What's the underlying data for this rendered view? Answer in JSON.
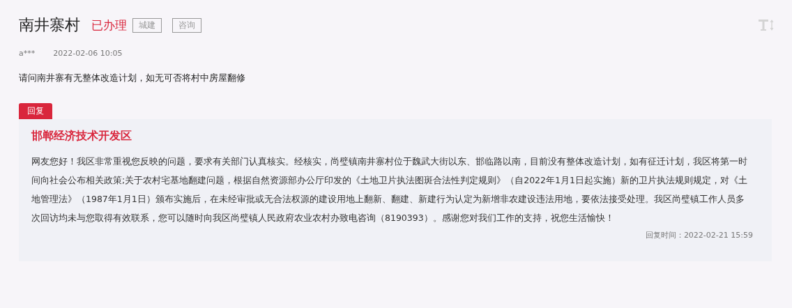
{
  "title": "南井寨村",
  "status": "已办理",
  "tags": [
    "城建",
    "咨询"
  ],
  "author": "a***",
  "posted": "2022-02-06 10:05",
  "question": "请问南井寨有无整体改造计划，如无可否将村中房屋翻修",
  "reply": {
    "label": "回复",
    "department": "邯郸经济技术开发区",
    "body": "网友您好！我区非常重视您反映的问题，要求有关部门认真核实。经核实，尚璧镇南井寨村位于魏武大街以东、邯临路以南，目前没有整体改造计划，如有征迁计划，我区将第一时间向社会公布相关政策;关于农村宅基地翻建问题，根据自然资源部办公厅印发的《土地卫片执法图斑合法性判定规则》（自2022年1月1日起实施）新的卫片执法规则规定，对《土地管理法》（1987年1月1日）颁布实施后，在未经审批或无合法权源的建设用地上翻新、翻建、新建行为认定为新增非农建设违法用地，要依法接受处理。我区尚璧镇工作人员多次回访均未与您取得有效联系，您可以随时向我区尚璧镇人民政府农业农村办致电咨询（8190393）。感谢您对我们工作的支持，祝您生活愉快！",
    "time": "回复时间：2022-02-21 15:59"
  }
}
